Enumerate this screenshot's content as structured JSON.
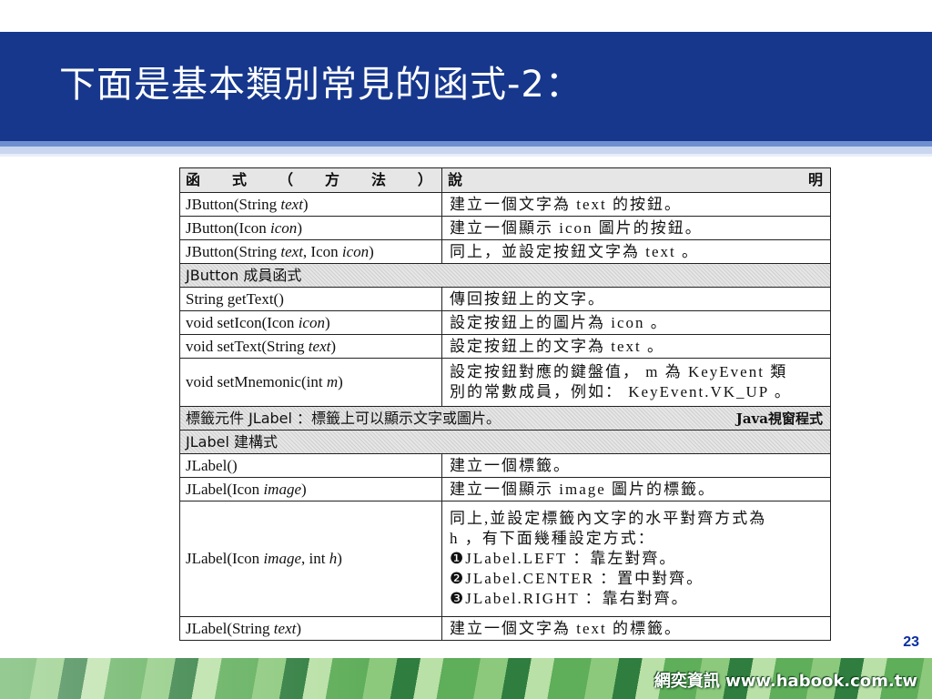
{
  "title": "下面是基本類別常見的函式-2：",
  "page_number": "23",
  "footer_brand": "網奕資訊 www.habook.com.tw",
  "table": {
    "header": {
      "col1": [
        "函",
        "式",
        "（",
        "方",
        "法",
        "）"
      ],
      "col2": [
        "說",
        "明"
      ]
    },
    "jbutton_rows": [
      {
        "pre": "JButton(String ",
        "it": "text",
        "post": ")",
        "pre2": "",
        "it2": "",
        "post2": "",
        "desc": "建立一個文字為 text 的按鈕。"
      },
      {
        "pre": "JButton(Icon ",
        "it": "icon",
        "post": ")",
        "pre2": "",
        "it2": "",
        "post2": "",
        "desc": "建立一個顯示 icon 圖片的按鈕。"
      },
      {
        "pre": "JButton(String ",
        "it": "text",
        "post": ", Icon ",
        "it2": "icon",
        "post2": ")",
        "desc": "同上，並設定按鈕文字為 text 。"
      }
    ],
    "section_jbutton_members": "JButton 成員函式",
    "member_rows": [
      {
        "pre": "String getText()",
        "it": "",
        "post": "",
        "desc": "傳回按鈕上的文字。"
      },
      {
        "pre": "void setIcon(Icon ",
        "it": "icon",
        "post": ")",
        "desc": "設定按鈕上的圖片為 icon 。"
      },
      {
        "pre": "void setText(String ",
        "it": "text",
        "post": ")",
        "desc": "設定按鈕上的文字為 text 。"
      }
    ],
    "mnemonic_row": {
      "pre": "void setMnemonic(int ",
      "it": "m",
      "post": ")",
      "desc_lines": [
        "設定按鈕對應的鍵盤值， m 為 KeyEvent 類",
        "別的常數成員，例如： KeyEvent.VK_UP 。"
      ]
    },
    "section_jlabel": {
      "text": "標籤元件 JLabel ：標籤上可以顯示文字或圖片。",
      "brand": "Java視窗程式"
    },
    "section_jlabel_ctor": "JLabel 建構式",
    "jlabel_rows": [
      {
        "pre": "JLabel()",
        "it": "",
        "post": "",
        "desc": "建立一個標籤。"
      },
      {
        "pre": "JLabel(Icon ",
        "it": "image",
        "post": ")",
        "desc": "建立一個顯示 image 圖片的標籤。"
      }
    ],
    "jlabel_align_row": {
      "pre": "JLabel(Icon ",
      "it": "image",
      "mid": ", int ",
      "it2": "h",
      "post": ")",
      "desc_lines": [
        "同上,並設定標籤內文字的水平對齊方式為",
        "h ，有下面幾種設定方式：",
        "❶JLabel.LEFT ：靠左對齊。",
        "❷JLabel.CENTER ：置中對齊。",
        "❸JLabel.RIGHT ：靠右對齊。"
      ]
    },
    "last_row": {
      "pre": "JLabel(String ",
      "it": "text",
      "post": ")",
      "desc": "建立一個文字為 text 的標籤。"
    }
  }
}
